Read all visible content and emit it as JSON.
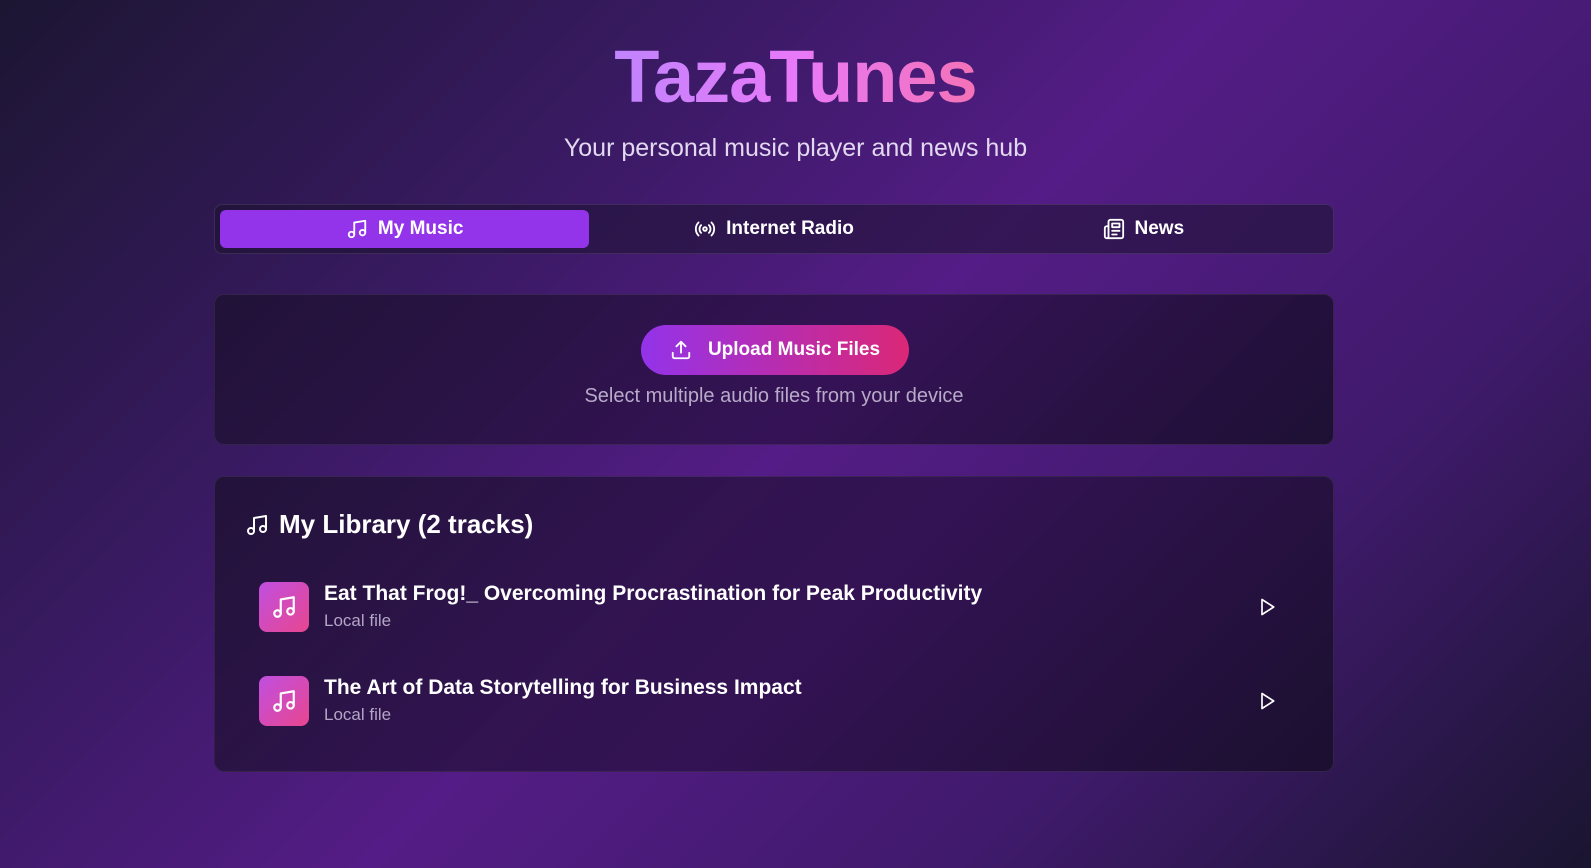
{
  "header": {
    "title": "TazaTunes",
    "subtitle": "Your personal music player and news hub"
  },
  "tabs": [
    {
      "label": "My Music",
      "icon": "music-note-icon",
      "active": true
    },
    {
      "label": "Internet Radio",
      "icon": "radio-broadcast-icon",
      "active": false
    },
    {
      "label": "News",
      "icon": "newspaper-icon",
      "active": false
    }
  ],
  "upload": {
    "button_label": "Upload Music Files",
    "hint": "Select multiple audio files from your device"
  },
  "library": {
    "heading": "My Library (2 tracks)",
    "tracks": [
      {
        "title": "Eat That Frog!_ Overcoming Procrastination for Peak Productivity",
        "source": "Local file"
      },
      {
        "title": "The Art of Data Storytelling for Business Impact",
        "source": "Local file"
      }
    ]
  },
  "colors": {
    "accent": "#9333ea",
    "accent_pink": "#db2777",
    "title_gradient_start": "#c084fc",
    "title_gradient_end": "#f472b6"
  }
}
